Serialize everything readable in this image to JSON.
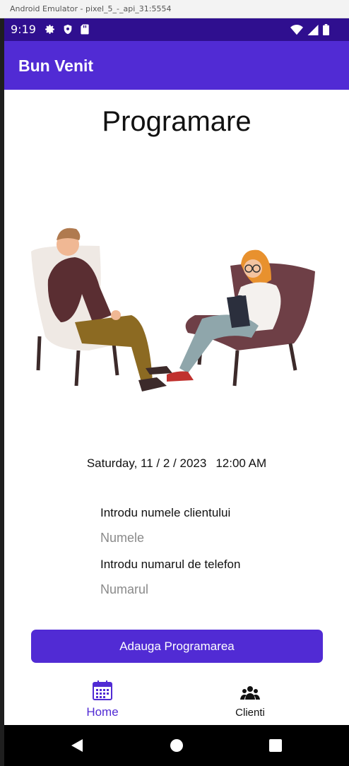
{
  "emulator": {
    "window_title": "Android Emulator - pixel_5_-_api_31:5554"
  },
  "status_bar": {
    "time": "9:19",
    "icons": [
      "gear-icon",
      "shield-icon",
      "sd-card-icon"
    ],
    "right_icons": [
      "wifi-icon",
      "signal-icon",
      "battery-icon"
    ]
  },
  "app_bar": {
    "title": "Bun Venit",
    "color": "#512bd4",
    "status_color": "#2f0f8f"
  },
  "main": {
    "heading": "Programare",
    "illustration": "therapy-session-illustration",
    "date": "Saturday, 11 / 2 / 2023",
    "time": "12:00 AM",
    "name_label": "Introdu numele clientului",
    "name_input": {
      "value": "",
      "placeholder": "Numele"
    },
    "phone_label": "Introdu numarul de telefon",
    "phone_input": {
      "value": "",
      "placeholder": "Numarul"
    },
    "submit_label": "Adauga Programarea"
  },
  "tabs": [
    {
      "label": "Home",
      "icon": "calendar-icon",
      "selected": true
    },
    {
      "label": "Clienti",
      "icon": "people-icon",
      "selected": false
    }
  ],
  "nav_bar": {
    "icons": [
      "back-icon",
      "home-icon",
      "recents-icon"
    ]
  }
}
